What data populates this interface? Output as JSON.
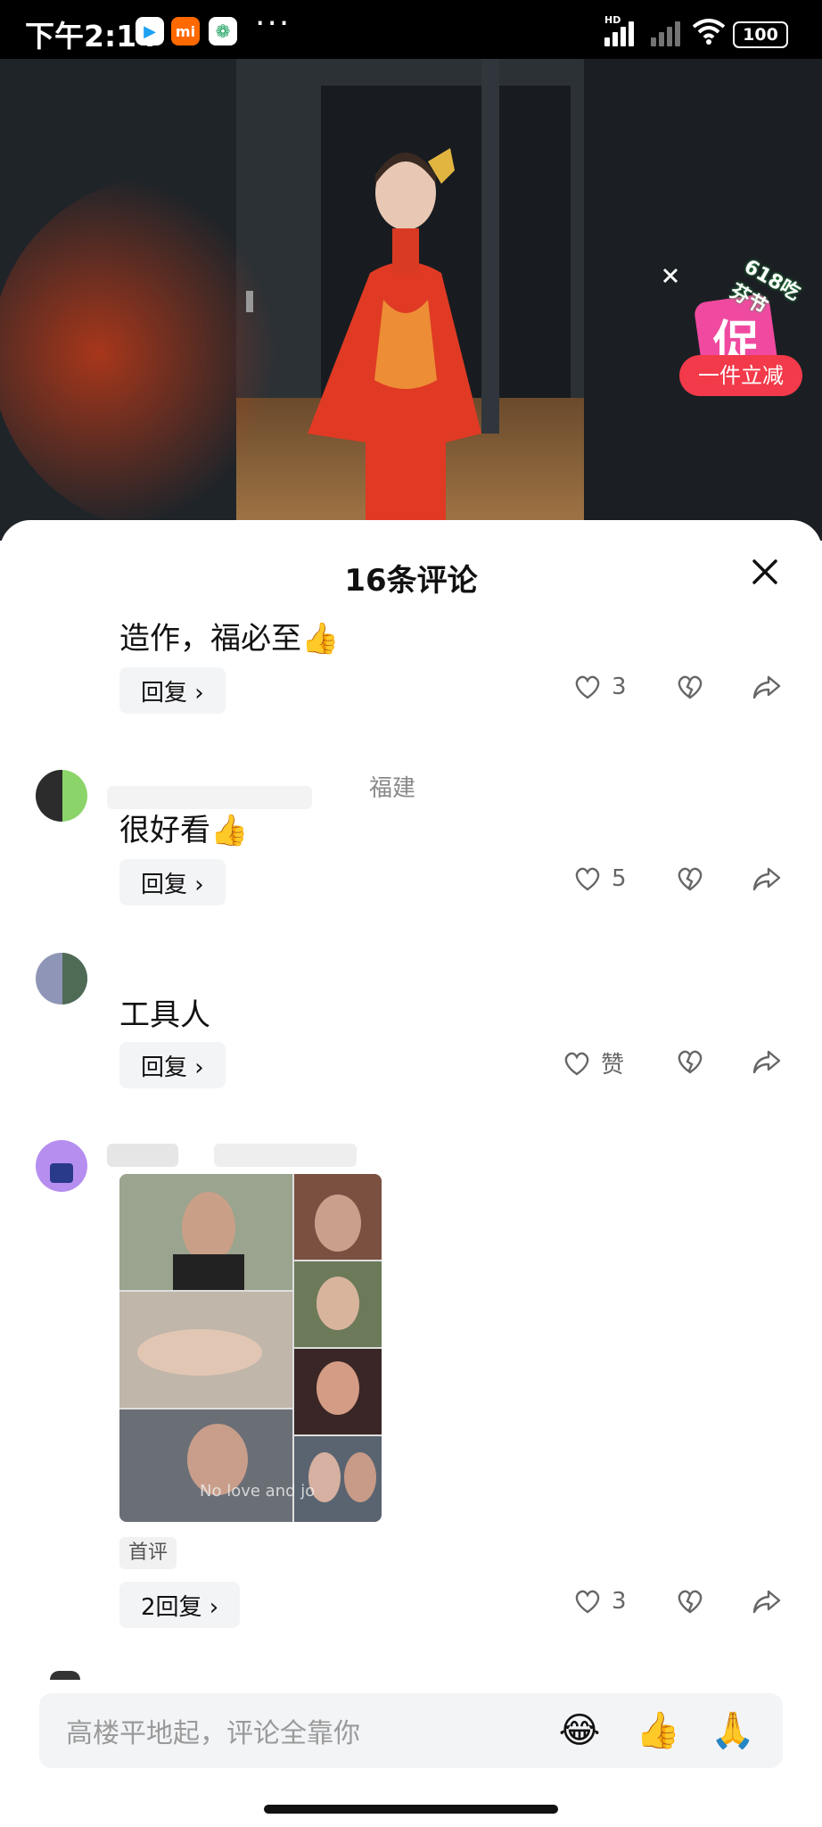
{
  "status_bar": {
    "time": "下午2:14",
    "battery": "100"
  },
  "promo": {
    "badge_text": "618吃芬节",
    "main_char": "促",
    "button": "一件立减"
  },
  "comments_panel": {
    "title": "16条评论",
    "comments": [
      {
        "text": "造作，福必至",
        "reply_label": "回复 ›",
        "likes": "3"
      },
      {
        "location": "福建",
        "text": "很好看",
        "reply_label": "回复 ›",
        "likes": "5"
      },
      {
        "text": "工具人",
        "reply_label": "回复 ›",
        "likes": "赞"
      },
      {
        "tag": "首评",
        "reply_label": "2回复 ›",
        "likes": "3",
        "image_caption": "No love and jo"
      }
    ]
  },
  "input": {
    "placeholder": "高楼平地起，评论全靠你"
  },
  "icons": [
    "heart-icon",
    "broken-heart-icon",
    "share-icon",
    "close-icon",
    "laugh-emoji-icon",
    "thumbs-up-emoji-icon",
    "praying-hands-emoji-icon"
  ],
  "colors": {
    "accent_red": "#f23a4a",
    "status_bg": "#000000",
    "sheet_bg": "#ffffff"
  }
}
